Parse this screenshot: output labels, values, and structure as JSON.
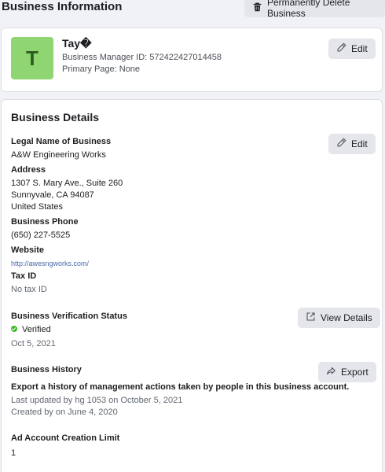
{
  "header": {
    "title": "Business Information",
    "delete_label": "Permanently Delete Business"
  },
  "profile": {
    "avatar_letter": "T",
    "name": "Tay�",
    "manager_id": "Business Manager ID: 572422427014458",
    "primary_page": "Primary Page: None",
    "edit_label": "Edit"
  },
  "details": {
    "title": "Business Details",
    "edit_label": "Edit",
    "legal_name_label": "Legal Name of Business",
    "legal_name": "A&W Engineering Works",
    "address_label": "Address",
    "address_line1": "1307 S. Mary Ave., Suite 260",
    "address_line2": "Sunnyvale, CA 94087",
    "address_line3": "United States",
    "phone_label": "Business Phone",
    "phone": "(650) 227-5525",
    "website_label": "Website",
    "website": "http://awesngworks.com/",
    "tax_label": "Tax ID",
    "tax_value": "No tax ID",
    "verification_label": "Business Verification Status",
    "verification_status": "Verified",
    "verification_date": "Oct 5, 2021",
    "view_details_label": "View Details",
    "history_label": "Business History",
    "export_label": "Export",
    "history_desc": "Export a history of management actions taken by people in this business account.",
    "last_updated": "Last updated by hg 1053 on October 5, 2021",
    "created_by": "Created by on June 4, 2020",
    "limit_label": "Ad Account Creation Limit",
    "limit_value": "1"
  },
  "colors": {
    "avatar_bg": "#8fd672",
    "verified_green": "#42b72a",
    "link_blue": "#4b6ba8"
  }
}
